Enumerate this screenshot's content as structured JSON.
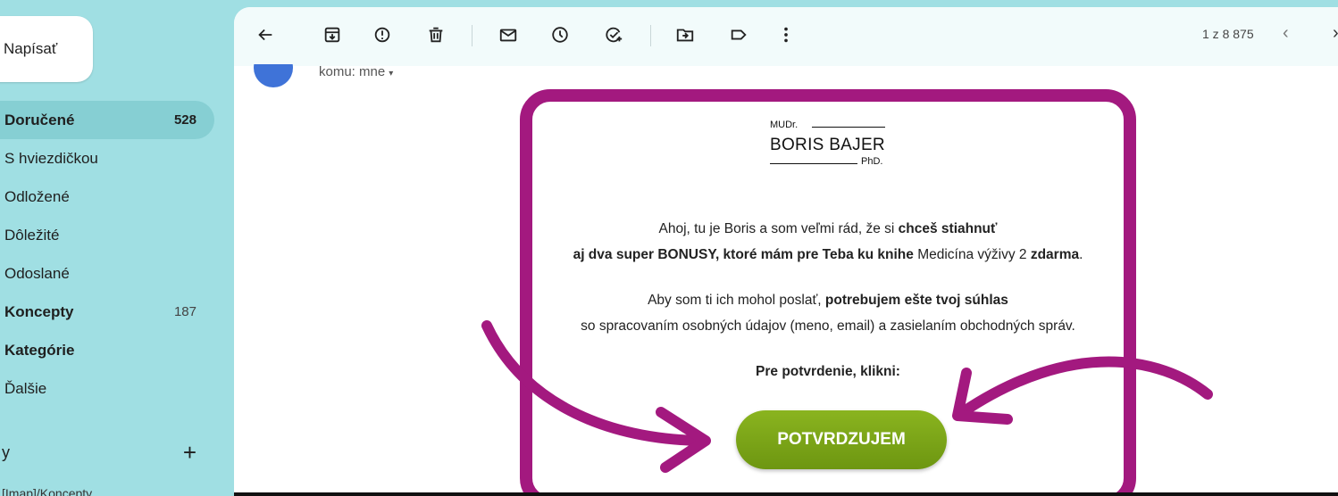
{
  "sidebar": {
    "compose_label": "Napísať",
    "items": [
      {
        "label": "Doručené",
        "count": "528"
      },
      {
        "label": "S hviezdičkou",
        "count": ""
      },
      {
        "label": "Odložené",
        "count": ""
      },
      {
        "label": "Dôležité",
        "count": ""
      },
      {
        "label": "Odoslané",
        "count": ""
      },
      {
        "label": "Koncepty",
        "count": "187"
      },
      {
        "label": "Kategórie",
        "count": ""
      },
      {
        "label": "Ďalšie",
        "count": ""
      }
    ],
    "labels_heading": "y",
    "add_label_symbol": "+",
    "cut_item": "[Imap]/Koncepty"
  },
  "toolbar": {
    "icons": [
      "back-arrow-icon",
      "archive-icon",
      "report-spam-icon",
      "delete-icon",
      "mark-unread-icon",
      "snooze-icon",
      "add-task-icon",
      "move-to-icon",
      "label-icon",
      "more-icon"
    ],
    "pager_text": "1 z 8 875",
    "prev_symbol": "‹",
    "next_symbol": "›"
  },
  "header": {
    "to_text": "komu: mne",
    "caret": "▾"
  },
  "email": {
    "logo": {
      "small": "MUDr.",
      "name": "BORIS BAJER",
      "phd": "PhD."
    },
    "p1_a": "Ahoj, tu je Boris a som veľmi rád, že si ",
    "p1_b": "chceš stiahnuť",
    "p1_c": "aj dva super BONUSY, ktoré mám pre Teba ku knihe",
    "p1_d": " Medicína výživy 2 ",
    "p1_e": "zdarma",
    "p1_f": ".",
    "p2_a": "Aby som ti ich mohol poslať, ",
    "p2_b": "potrebujem ešte tvoj súhlas",
    "p2_c": "so spracovaním osobných údajov (meno, email) a zasielaním obchodných správ.",
    "p3": "Pre potvrdenie, klikni:",
    "cta_label": "POTVRDZUJEM"
  },
  "colors": {
    "sidebar_bg": "#a0dfe3",
    "frame_accent": "#a3197f",
    "cta_green": "#7ba518"
  }
}
